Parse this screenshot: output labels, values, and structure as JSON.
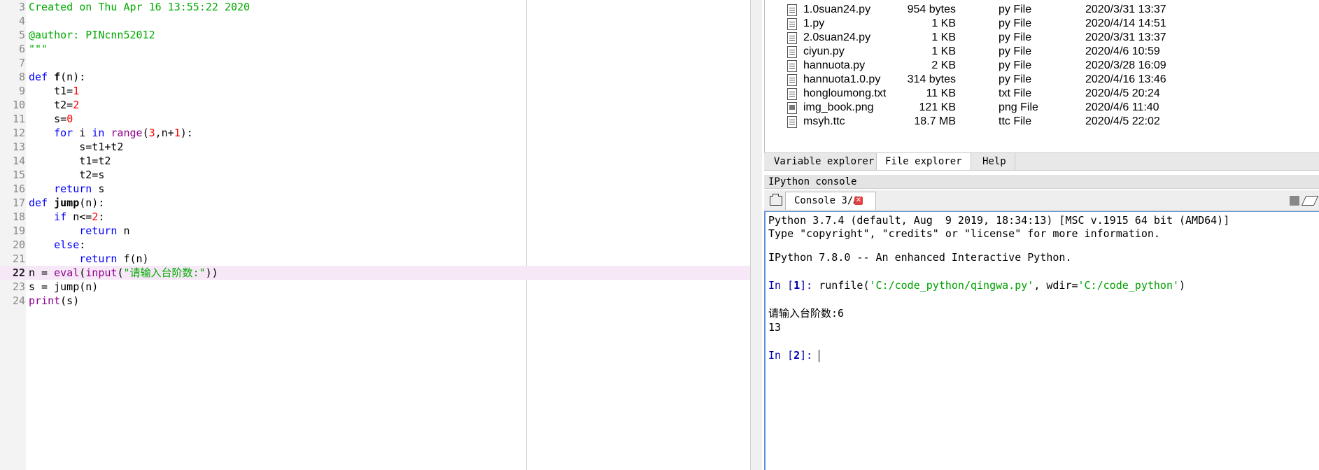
{
  "editor": {
    "lines": [
      {
        "num": "3",
        "tokens": [
          {
            "t": "Created on Thu Apr 16 13:55:22 2020",
            "c": "cmt"
          }
        ]
      },
      {
        "num": "4",
        "tokens": []
      },
      {
        "num": "5",
        "tokens": [
          {
            "t": "@author: PINcnn52012",
            "c": "cmt"
          }
        ]
      },
      {
        "num": "6",
        "tokens": [
          {
            "t": "\"\"\"",
            "c": "cmt"
          }
        ]
      },
      {
        "num": "7",
        "tokens": []
      },
      {
        "num": "8",
        "tokens": [
          {
            "t": "def ",
            "c": "kw"
          },
          {
            "t": "f",
            "c": "fn"
          },
          {
            "t": "(n):",
            "c": ""
          }
        ]
      },
      {
        "num": "9",
        "tokens": [
          {
            "t": "    t1=",
            "c": ""
          },
          {
            "t": "1",
            "c": "num"
          }
        ]
      },
      {
        "num": "10",
        "tokens": [
          {
            "t": "    t2=",
            "c": ""
          },
          {
            "t": "2",
            "c": "num"
          }
        ]
      },
      {
        "num": "11",
        "tokens": [
          {
            "t": "    s=",
            "c": ""
          },
          {
            "t": "0",
            "c": "num"
          }
        ]
      },
      {
        "num": "12",
        "tokens": [
          {
            "t": "    ",
            "c": ""
          },
          {
            "t": "for",
            "c": "kw"
          },
          {
            "t": " i ",
            "c": ""
          },
          {
            "t": "in",
            "c": "kw"
          },
          {
            "t": " ",
            "c": ""
          },
          {
            "t": "range",
            "c": "bi"
          },
          {
            "t": "(",
            "c": ""
          },
          {
            "t": "3",
            "c": "num"
          },
          {
            "t": ",n+",
            "c": ""
          },
          {
            "t": "1",
            "c": "num"
          },
          {
            "t": "):",
            "c": ""
          }
        ]
      },
      {
        "num": "13",
        "tokens": [
          {
            "t": "        s=t1+t2",
            "c": ""
          }
        ]
      },
      {
        "num": "14",
        "tokens": [
          {
            "t": "        t1=t2",
            "c": ""
          }
        ]
      },
      {
        "num": "15",
        "tokens": [
          {
            "t": "        t2=s",
            "c": ""
          }
        ]
      },
      {
        "num": "16",
        "tokens": [
          {
            "t": "    ",
            "c": ""
          },
          {
            "t": "return",
            "c": "kw"
          },
          {
            "t": " s",
            "c": ""
          }
        ]
      },
      {
        "num": "17",
        "tokens": [
          {
            "t": "def ",
            "c": "kw"
          },
          {
            "t": "jump",
            "c": "fn"
          },
          {
            "t": "(n):",
            "c": ""
          }
        ]
      },
      {
        "num": "18",
        "tokens": [
          {
            "t": "    ",
            "c": ""
          },
          {
            "t": "if",
            "c": "kw"
          },
          {
            "t": " n<=",
            "c": ""
          },
          {
            "t": "2",
            "c": "num"
          },
          {
            "t": ":",
            "c": ""
          }
        ]
      },
      {
        "num": "19",
        "tokens": [
          {
            "t": "        ",
            "c": ""
          },
          {
            "t": "return",
            "c": "kw"
          },
          {
            "t": " n",
            "c": ""
          }
        ]
      },
      {
        "num": "20",
        "tokens": [
          {
            "t": "    ",
            "c": ""
          },
          {
            "t": "else",
            "c": "kw"
          },
          {
            "t": ":",
            "c": ""
          }
        ]
      },
      {
        "num": "21",
        "tokens": [
          {
            "t": "        ",
            "c": ""
          },
          {
            "t": "return",
            "c": "kw"
          },
          {
            "t": " f(n)",
            "c": ""
          }
        ]
      },
      {
        "num": "22",
        "current": true,
        "tokens": [
          {
            "t": "n = ",
            "c": ""
          },
          {
            "t": "eval",
            "c": "bi"
          },
          {
            "t": "(",
            "c": ""
          },
          {
            "t": "input",
            "c": "bi"
          },
          {
            "t": "(",
            "c": ""
          },
          {
            "t": "\"请输入台阶数:\"",
            "c": "str"
          },
          {
            "t": "))",
            "c": ""
          }
        ]
      },
      {
        "num": "23",
        "tokens": [
          {
            "t": "s = jump(n)",
            "c": ""
          }
        ]
      },
      {
        "num": "24",
        "tokens": [
          {
            "t": "print",
            "c": "bi"
          },
          {
            "t": "(s)",
            "c": ""
          }
        ]
      }
    ]
  },
  "file_explorer": {
    "files": [
      {
        "name": "1.0suan24.py",
        "size": "954 bytes",
        "type": "py File",
        "date": "2020/3/31 13:37",
        "icon": "file-icon"
      },
      {
        "name": "1.py",
        "size": "1 KB",
        "type": "py File",
        "date": "2020/4/14 14:51",
        "icon": "file-icon"
      },
      {
        "name": "2.0suan24.py",
        "size": "1 KB",
        "type": "py File",
        "date": "2020/3/31 13:37",
        "icon": "file-icon"
      },
      {
        "name": "ciyun.py",
        "size": "1 KB",
        "type": "py File",
        "date": "2020/4/6 10:59",
        "icon": "file-icon"
      },
      {
        "name": "hannuota.py",
        "size": "2 KB",
        "type": "py File",
        "date": "2020/3/28 16:09",
        "icon": "file-icon"
      },
      {
        "name": "hannuota1.0.py",
        "size": "314 bytes",
        "type": "py File",
        "date": "2020/4/16 13:46",
        "icon": "file-icon"
      },
      {
        "name": "hongloumong.txt",
        "size": "11 KB",
        "type": "txt File",
        "date": "2020/4/5 20:24",
        "icon": "file-icon"
      },
      {
        "name": "img_book.png",
        "size": "121 KB",
        "type": "png File",
        "date": "2020/4/6 11:40",
        "icon": "image-file-icon"
      },
      {
        "name": "msyh.ttc",
        "size": "18.7 MB",
        "type": "ttc File",
        "date": "2020/4/5 22:02",
        "icon": "file-icon"
      }
    ],
    "tabs": [
      {
        "label": "Variable explorer",
        "active": false
      },
      {
        "label": "File explorer",
        "active": true
      },
      {
        "label": "Help",
        "active": false
      }
    ]
  },
  "console": {
    "pane_title": "IPython console",
    "tab_label": "Console 3/A",
    "close_glyph": "✕",
    "banner1": "Python 3.7.4 (default, Aug  9 2019, 18:34:13) [MSC v.1915 64 bit (AMD64)]",
    "banner2": "Type \"copyright\", \"credits\" or \"license\" for more information.",
    "banner3": "IPython 7.8.0 -- An enhanced Interactive Python.",
    "in1_prompt_a": "In [",
    "in1_num": "1",
    "in1_prompt_b": "]: ",
    "in1_cmd_a": "runfile(",
    "in1_str1": "'C:/code_python/qingwa.py'",
    "in1_cmd_b": ", wdir=",
    "in1_str2": "'C:/code_python'",
    "in1_cmd_c": ")",
    "out_prompt": "请输入台阶数:6",
    "out_value": "13",
    "in2_prompt_a": "In [",
    "in2_num": "2",
    "in2_prompt_b": "]: "
  }
}
